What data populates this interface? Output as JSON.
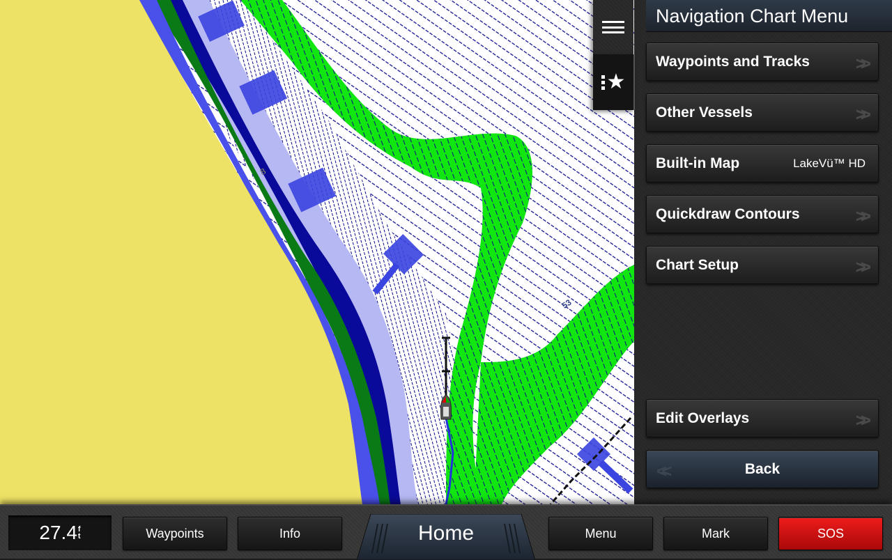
{
  "map": {
    "colors": {
      "land": "#ede265",
      "shallow_blue": "#4a50ea",
      "dark_green": "#0a7a16",
      "navy": "#0a0a9a",
      "light_blue": "#b6b8f4",
      "water": "#ffffff",
      "contour": "#0a0a8a",
      "green_zone": "#11e611",
      "overlay_blue": "#3a44e0"
    },
    "depth_labels": [
      "8",
      "53"
    ],
    "vessel_icon": "boat-icon"
  },
  "side_tabs": {
    "menu_icon": "hamburger-icon",
    "favorites_icon": "favorites-star-icon"
  },
  "menu": {
    "title": "Navigation Chart Menu",
    "items": [
      {
        "label": "Waypoints and Tracks",
        "icon": "double-chevron-right-icon"
      },
      {
        "label": "Other Vessels",
        "icon": "double-chevron-right-icon"
      },
      {
        "label": "Built-in Map",
        "value": "LakeVü™ HD"
      },
      {
        "label": "Quickdraw Contours",
        "icon": "double-chevron-right-icon"
      },
      {
        "label": "Chart Setup",
        "icon": "double-chevron-right-icon"
      },
      {
        "label": "Edit Overlays",
        "icon": "double-chevron-right-icon"
      }
    ],
    "back_label": "Back",
    "back_icon": "double-chevron-left-icon"
  },
  "bottom_bar": {
    "depth_value": "27.4",
    "depth_unit_top": "f",
    "depth_unit_bottom": "t",
    "buttons": {
      "waypoints": "Waypoints",
      "info": "Info",
      "home": "Home",
      "menu": "Menu",
      "mark": "Mark",
      "sos": "SOS"
    },
    "sos_color": "#d81010"
  }
}
